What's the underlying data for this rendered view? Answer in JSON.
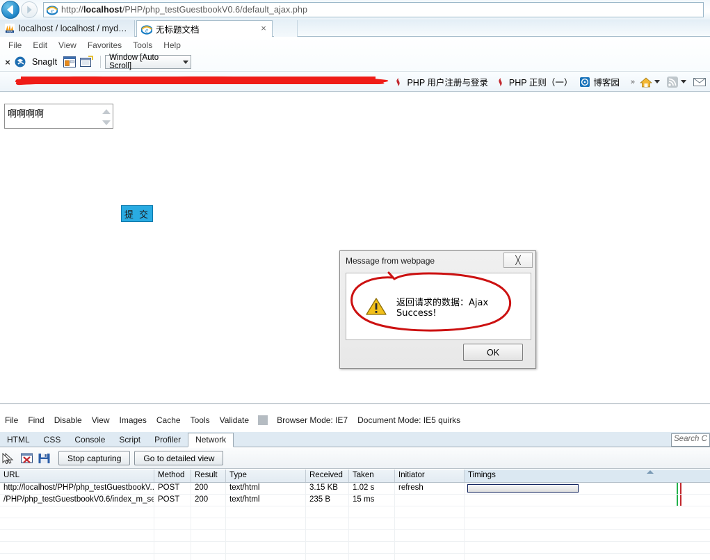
{
  "browser": {
    "address_bar": {
      "url_prefix": "http://",
      "url_host": "localhost",
      "url_suffix": "/PHP/php_testGuestbookV0.6/default_ajax.php",
      "full_url": "http://localhost/PHP/php_testGuestbookV0.6/default_ajax.php"
    },
    "nav": {
      "back_label": "Back",
      "forward_label": "Forward"
    },
    "tabs": [
      {
        "label": "localhost / localhost / mydb_t...",
        "icon": "phpmyadmin-icon",
        "active": false
      },
      {
        "label": "无标题文档",
        "icon": "ie-icon",
        "active": true,
        "close_label": "×"
      }
    ],
    "menu": [
      "File",
      "Edit",
      "View",
      "Favorites",
      "Tools",
      "Help"
    ],
    "snagit_toolbar": {
      "close_label": "×",
      "app_name": "SnagIt",
      "mode_value": "Window [Auto Scroll]",
      "icons": [
        "snagit-logo-icon",
        "capture-window-icon",
        "capture-region-icon"
      ]
    },
    "links_bar": {
      "items": [
        {
          "label": "PHP 用户注册与登录",
          "icon": "php-bookmark-icon"
        },
        {
          "label": "PHP 正则（一）",
          "icon": "php-bookmark-icon"
        },
        {
          "label": "博客园",
          "icon": "cnblogs-icon"
        }
      ],
      "overflow_label": "»",
      "right_icons": [
        "home-icon",
        "chevron-down-icon",
        "feed-icon",
        "chevron-down-icon",
        "mail-icon"
      ],
      "redaction_color": "#ef1c17"
    }
  },
  "page": {
    "textarea": {
      "value": "啊啊啊啊",
      "placeholder": ""
    },
    "submit_button": {
      "label": "提 交",
      "color": "#29ABE2"
    }
  },
  "dialog": {
    "title": "Message from webpage",
    "close_label": "╳",
    "message": "返回请求的数据：Ajax Success!",
    "ok_label": "OK",
    "icon": "warning-icon",
    "annotation_color": "#cc1111"
  },
  "devtools": {
    "menu": [
      "File",
      "Find",
      "Disable",
      "View",
      "Images",
      "Cache",
      "Tools",
      "Validate"
    ],
    "browser_mode": "Browser Mode: IE7",
    "document_mode": "Document Mode: IE5 quirks",
    "tabs": [
      "HTML",
      "CSS",
      "Console",
      "Script",
      "Profiler",
      "Network"
    ],
    "selected_tab": "Network",
    "search_placeholder": "Search C",
    "toolbar": {
      "icons": [
        "pointer-icon",
        "clear-entries-icon",
        "save-icon"
      ],
      "stop_capturing_label": "Stop capturing",
      "detailed_view_label": "Go to detailed view"
    },
    "network_table": {
      "columns": [
        "URL",
        "Method",
        "Result",
        "Type",
        "Received",
        "Taken",
        "Initiator",
        "Timings"
      ],
      "rows": [
        {
          "url": "http://localhost/PHP/php_testGuestbookV...",
          "method": "POST",
          "result": "200",
          "type": "text/html",
          "received": "3.15 KB",
          "taken": "1.02 s",
          "initiator": "refresh",
          "timing_bar": true
        },
        {
          "url": "/PHP/php_testGuestbookV0.6/index_m_se...",
          "method": "POST",
          "result": "200",
          "type": "text/html",
          "received": "235 B",
          "taken": "15 ms",
          "initiator": "",
          "timing_bar": false
        }
      ],
      "timing_marker_colors": {
        "green": "#22b14c",
        "red": "#c1272d"
      }
    }
  }
}
